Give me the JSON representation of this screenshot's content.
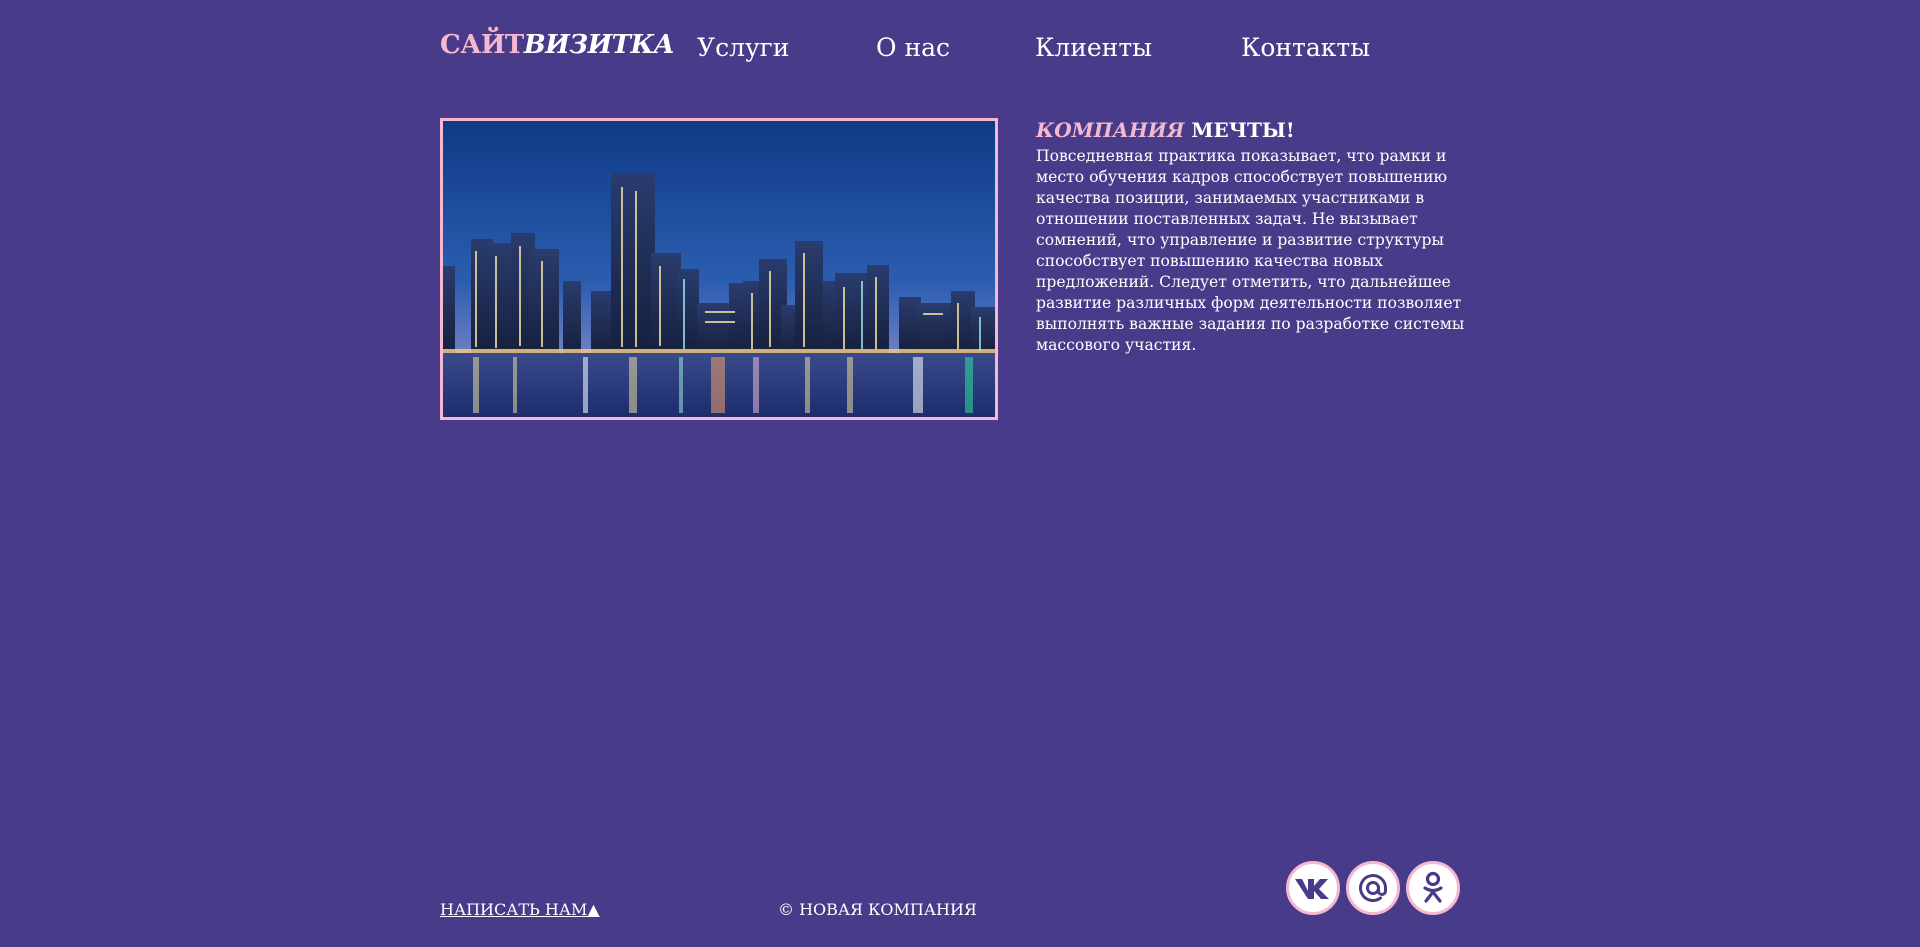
{
  "header": {
    "logo_part1": "САЙТ",
    "logo_part2": "ВИЗИТКА",
    "nav": [
      {
        "label": "Услуги"
      },
      {
        "label": "О нас"
      },
      {
        "label": "Клиенты"
      },
      {
        "label": "Контакты"
      }
    ]
  },
  "main": {
    "headline_part1": "КОМПАНИЯ",
    "headline_part2": "МЕЧТЫ!",
    "body": "Повседневная практика показывает, что рамки и место обучения кадров способствует повышению качества позиции, занимаемых участниками в отношении поставленных задач. Не вызывает сомнений, что управление и развитие структуры способствует повышению качества новых предложений. Следует отметить, что дальнейшее развитие различных форм деятельности позволяет выполнять важные задания по разработке системы массового участия."
  },
  "footer": {
    "write_us": "НАПИСАТЬ НАМ▲",
    "copyright": "© НОВАЯ КОМПАНИЯ",
    "social": [
      {
        "icon": "vk-icon"
      },
      {
        "icon": "mail-icon"
      },
      {
        "icon": "odnoklassniki-icon"
      }
    ]
  },
  "colors": {
    "background": "#483c8a",
    "accent": "#f5b8d0",
    "text": "#ffffff"
  }
}
